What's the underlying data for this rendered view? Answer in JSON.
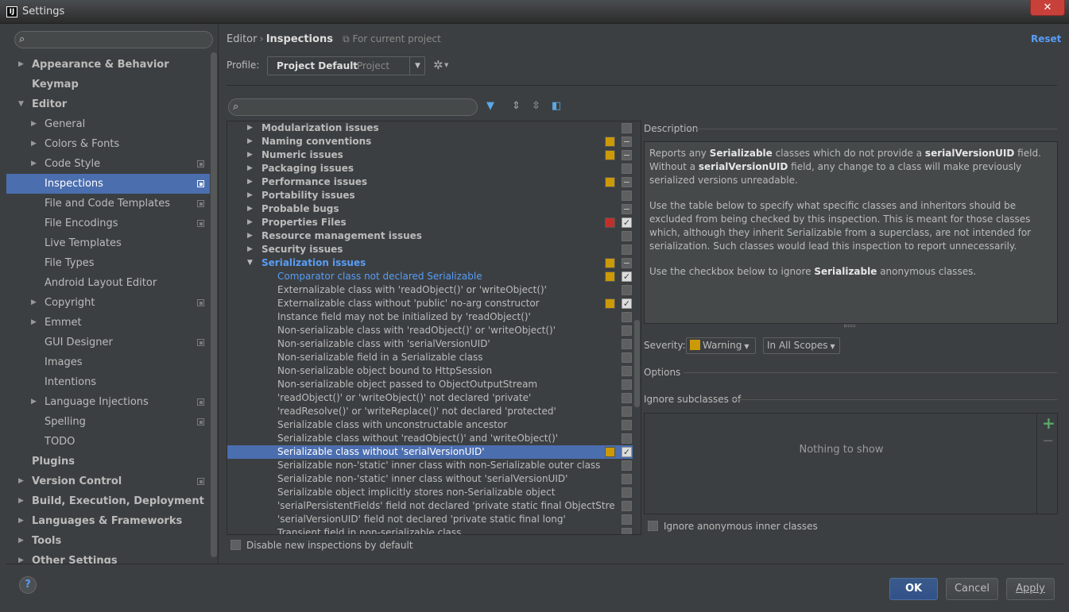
{
  "window": {
    "title": "Settings",
    "app_icon_text": "IJ",
    "close_label": "✕"
  },
  "sidebar": {
    "search_placeholder": "",
    "items": [
      {
        "label": "Appearance & Behavior",
        "level": 0,
        "bold": true,
        "arrow": "▶",
        "project": false,
        "selected": false
      },
      {
        "label": "Keymap",
        "level": 0,
        "bold": true,
        "arrow": "",
        "project": false,
        "selected": false
      },
      {
        "label": "Editor",
        "level": 0,
        "bold": true,
        "arrow": "▼",
        "project": false,
        "selected": false
      },
      {
        "label": "General",
        "level": 1,
        "bold": false,
        "arrow": "▶",
        "project": false,
        "selected": false
      },
      {
        "label": "Colors & Fonts",
        "level": 1,
        "bold": false,
        "arrow": "▶",
        "project": false,
        "selected": false
      },
      {
        "label": "Code Style",
        "level": 1,
        "bold": false,
        "arrow": "▶",
        "project": true,
        "selected": false
      },
      {
        "label": "Inspections",
        "level": 1,
        "bold": false,
        "arrow": "",
        "project": true,
        "selected": true
      },
      {
        "label": "File and Code Templates",
        "level": 1,
        "bold": false,
        "arrow": "",
        "project": true,
        "selected": false
      },
      {
        "label": "File Encodings",
        "level": 1,
        "bold": false,
        "arrow": "",
        "project": true,
        "selected": false
      },
      {
        "label": "Live Templates",
        "level": 1,
        "bold": false,
        "arrow": "",
        "project": false,
        "selected": false
      },
      {
        "label": "File Types",
        "level": 1,
        "bold": false,
        "arrow": "",
        "project": false,
        "selected": false
      },
      {
        "label": "Android Layout Editor",
        "level": 1,
        "bold": false,
        "arrow": "",
        "project": false,
        "selected": false
      },
      {
        "label": "Copyright",
        "level": 1,
        "bold": false,
        "arrow": "▶",
        "project": true,
        "selected": false
      },
      {
        "label": "Emmet",
        "level": 1,
        "bold": false,
        "arrow": "▶",
        "project": false,
        "selected": false
      },
      {
        "label": "GUI Designer",
        "level": 1,
        "bold": false,
        "arrow": "",
        "project": true,
        "selected": false
      },
      {
        "label": "Images",
        "level": 1,
        "bold": false,
        "arrow": "",
        "project": false,
        "selected": false
      },
      {
        "label": "Intentions",
        "level": 1,
        "bold": false,
        "arrow": "",
        "project": false,
        "selected": false
      },
      {
        "label": "Language Injections",
        "level": 1,
        "bold": false,
        "arrow": "▶",
        "project": true,
        "selected": false
      },
      {
        "label": "Spelling",
        "level": 1,
        "bold": false,
        "arrow": "",
        "project": true,
        "selected": false
      },
      {
        "label": "TODO",
        "level": 1,
        "bold": false,
        "arrow": "",
        "project": false,
        "selected": false
      },
      {
        "label": "Plugins",
        "level": 0,
        "bold": true,
        "arrow": "",
        "project": false,
        "selected": false
      },
      {
        "label": "Version Control",
        "level": 0,
        "bold": true,
        "arrow": "▶",
        "project": true,
        "selected": false
      },
      {
        "label": "Build, Execution, Deployment",
        "level": 0,
        "bold": true,
        "arrow": "▶",
        "project": false,
        "selected": false
      },
      {
        "label": "Languages & Frameworks",
        "level": 0,
        "bold": true,
        "arrow": "▶",
        "project": false,
        "selected": false
      },
      {
        "label": "Tools",
        "level": 0,
        "bold": true,
        "arrow": "▶",
        "project": false,
        "selected": false
      },
      {
        "label": "Other Settings",
        "level": 0,
        "bold": true,
        "arrow": "▶",
        "project": false,
        "selected": false
      }
    ]
  },
  "header": {
    "crumb_parent": "Editor",
    "crumb_sep": "›",
    "crumb_current": "Inspections",
    "scope_text": "For current project",
    "reset_label": "Reset"
  },
  "profile": {
    "label": "Profile:",
    "name": "Project Default",
    "type": "Project"
  },
  "inspections": {
    "search_placeholder": "",
    "rows": [
      {
        "label": "Modularization issues",
        "kind": "group",
        "arrow": "▶",
        "severity": "",
        "check": "off",
        "selected": false
      },
      {
        "label": "Naming conventions",
        "kind": "group",
        "arrow": "▶",
        "severity": "#cc9a06",
        "check": "mixed",
        "selected": false
      },
      {
        "label": "Numeric issues",
        "kind": "group",
        "arrow": "▶",
        "severity": "#cc9a06",
        "check": "mixed",
        "selected": false
      },
      {
        "label": "Packaging issues",
        "kind": "group",
        "arrow": "▶",
        "severity": "",
        "check": "off",
        "selected": false
      },
      {
        "label": "Performance issues",
        "kind": "group",
        "arrow": "▶",
        "severity": "#cc9a06",
        "check": "mixed",
        "selected": false
      },
      {
        "label": "Portability issues",
        "kind": "group",
        "arrow": "▶",
        "severity": "",
        "check": "off",
        "selected": false
      },
      {
        "label": "Probable bugs",
        "kind": "group",
        "arrow": "▶",
        "severity": "",
        "check": "mixed",
        "selected": false
      },
      {
        "label": "Properties Files",
        "kind": "group",
        "arrow": "▶",
        "severity": "#c0302a",
        "check": "checked",
        "selected": false
      },
      {
        "label": "Resource management issues",
        "kind": "group",
        "arrow": "▶",
        "severity": "",
        "check": "off",
        "selected": false
      },
      {
        "label": "Security issues",
        "kind": "group",
        "arrow": "▶",
        "severity": "",
        "check": "off",
        "selected": false
      },
      {
        "label": "Serialization issues",
        "kind": "group-open",
        "arrow": "▼",
        "severity": "#cc9a06",
        "check": "mixed",
        "selected": false
      },
      {
        "label": "Comparator class not declared Serializable",
        "kind": "child-link",
        "arrow": "",
        "severity": "#cc9a06",
        "check": "checked",
        "selected": false
      },
      {
        "label": "Externalizable class with 'readObject()' or 'writeObject()'",
        "kind": "child",
        "arrow": "",
        "severity": "",
        "check": "off",
        "selected": false
      },
      {
        "label": "Externalizable class without 'public' no-arg constructor",
        "kind": "child",
        "arrow": "",
        "severity": "#cc9a06",
        "check": "checked",
        "selected": false
      },
      {
        "label": "Instance field may not be initialized by 'readObject()'",
        "kind": "child",
        "arrow": "",
        "severity": "",
        "check": "off",
        "selected": false
      },
      {
        "label": "Non-serializable class with 'readObject()' or 'writeObject()'",
        "kind": "child",
        "arrow": "",
        "severity": "",
        "check": "off",
        "selected": false
      },
      {
        "label": "Non-serializable class with 'serialVersionUID'",
        "kind": "child",
        "arrow": "",
        "severity": "",
        "check": "off",
        "selected": false
      },
      {
        "label": "Non-serializable field in a Serializable class",
        "kind": "child",
        "arrow": "",
        "severity": "",
        "check": "off",
        "selected": false
      },
      {
        "label": "Non-serializable object bound to HttpSession",
        "kind": "child",
        "arrow": "",
        "severity": "",
        "check": "off",
        "selected": false
      },
      {
        "label": "Non-serializable object passed to ObjectOutputStream",
        "kind": "child",
        "arrow": "",
        "severity": "",
        "check": "off",
        "selected": false
      },
      {
        "label": "'readObject()' or 'writeObject()' not declared 'private'",
        "kind": "child",
        "arrow": "",
        "severity": "",
        "check": "off",
        "selected": false
      },
      {
        "label": "'readResolve()' or 'writeReplace()' not declared 'protected'",
        "kind": "child",
        "arrow": "",
        "severity": "",
        "check": "off",
        "selected": false
      },
      {
        "label": "Serializable class with unconstructable ancestor",
        "kind": "child",
        "arrow": "",
        "severity": "",
        "check": "off",
        "selected": false
      },
      {
        "label": "Serializable class without 'readObject()' and 'writeObject()'",
        "kind": "child",
        "arrow": "",
        "severity": "",
        "check": "off",
        "selected": false
      },
      {
        "label": "Serializable class without 'serialVersionUID'",
        "kind": "child",
        "arrow": "",
        "severity": "#cc9a06",
        "check": "checked",
        "selected": true
      },
      {
        "label": "Serializable non-'static' inner class with non-Serializable outer class",
        "kind": "child",
        "arrow": "",
        "severity": "",
        "check": "off",
        "selected": false
      },
      {
        "label": "Serializable non-'static' inner class without 'serialVersionUID'",
        "kind": "child",
        "arrow": "",
        "severity": "",
        "check": "off",
        "selected": false
      },
      {
        "label": "Serializable object implicitly stores non-Serializable object",
        "kind": "child",
        "arrow": "",
        "severity": "",
        "check": "off",
        "selected": false
      },
      {
        "label": "'serialPersistentFields' field not declared 'private static final ObjectStre",
        "kind": "child",
        "arrow": "",
        "severity": "",
        "check": "off",
        "selected": false
      },
      {
        "label": "'serialVersionUID' field not declared 'private static final long'",
        "kind": "child",
        "arrow": "",
        "severity": "",
        "check": "off",
        "selected": false
      },
      {
        "label": "Transient field in non-serializable class",
        "kind": "child",
        "arrow": "",
        "severity": "",
        "check": "off",
        "selected": false
      }
    ],
    "disable_new_label": "Disable new inspections by default"
  },
  "description": {
    "title": "Description",
    "p1": [
      {
        "t": "Reports any ",
        "b": false
      },
      {
        "t": "Serializable",
        "b": true
      },
      {
        "t": " classes which do not provide a ",
        "b": false
      },
      {
        "t": "serialVersionUID",
        "b": true
      },
      {
        "t": " field. Without a ",
        "b": false
      },
      {
        "t": "serialVersionUID",
        "b": true
      },
      {
        "t": " field, any change to a class will make previously serialized versions unreadable.",
        "b": false
      }
    ],
    "p2": [
      {
        "t": "Use the table below to specify what specific classes and inheritors should be excluded from being checked by this inspection. This is meant for those classes which, although they inherit Serializable from a superclass, are not intended for serialization. Such classes would lead this inspection to report unnecessarily.",
        "b": false
      }
    ],
    "p3": [
      {
        "t": "Use the checkbox below to ignore ",
        "b": false
      },
      {
        "t": "Serializable",
        "b": true
      },
      {
        "t": " anonymous classes.",
        "b": false
      }
    ]
  },
  "severity": {
    "label": "Severity:",
    "value": "Warning",
    "color": "#cc9a06",
    "scope": "In All Scopes"
  },
  "options": {
    "title": "Options",
    "ignore_subclasses_title": "Ignore subclasses of",
    "empty_text": "Nothing to show",
    "add_label": "+",
    "remove_label": "−",
    "ignore_anon_label": "Ignore anonymous inner classes"
  },
  "footer": {
    "help_label": "?",
    "ok_label": "OK",
    "cancel_label": "Cancel",
    "apply_label": "Apply"
  }
}
